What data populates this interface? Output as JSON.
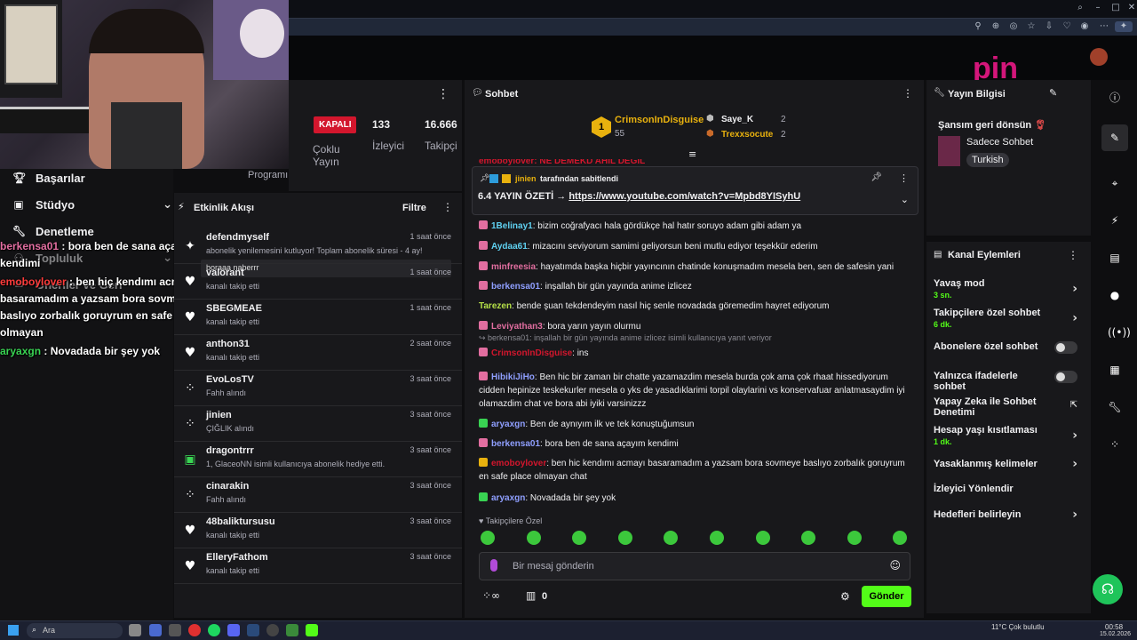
{
  "browser": {
    "icons": [
      "search-icon",
      "minimize-icon",
      "maximize-icon",
      "close-icon"
    ]
  },
  "brand": {
    "logo_text": "pin"
  },
  "left_nav": {
    "items": [
      {
        "label": "Başarılar",
        "icon": "trophy-icon"
      },
      {
        "label": "Stüdyo",
        "icon": "studio-icon"
      },
      {
        "label": "Denetleme",
        "icon": "wrench-icon"
      },
      {
        "label": "Topluluk",
        "icon": "community-icon"
      },
      {
        "label": "Oneriler ve Geri",
        "icon": "feedback-icon"
      }
    ]
  },
  "overlay_chat": [
    {
      "user": "berkensa01",
      "text": " : bora ben de sana açayım kendimi",
      "color": "#e26ea0"
    },
    {
      "user": "emoboylover",
      "text": " : ben hiç kendımı acmayı basaramadım a yazsam bora sovmeye baslıyo zorbalık goruyrum en safe place olmayan",
      "color": "#d3162d"
    },
    {
      "user": "aryaxgn",
      "text": " : Novadada bir şey yok",
      "color": "#39d353"
    }
  ],
  "stream_status": {
    "status": "KAPALI",
    "multi_stream": "Çoklu Yayın",
    "viewers": "133",
    "viewers_label": "İzleyici",
    "followers": "16.666",
    "followers_label": "Takipçi",
    "program_label": "Programı"
  },
  "activity": {
    "title": "Etkinlik Akışı",
    "filter": "Filtre",
    "pinned_input": "boraaa naberrr",
    "rows": [
      {
        "name": "defendmyself",
        "sub": "abonelik yenilemesini kutluyor! Toplam abonelik süresi - 4 ay!",
        "time": "1 saat önce",
        "icon": "star-icon"
      },
      {
        "name": "valorant",
        "sub": "kanalı takip etti",
        "time": "1 saat önce",
        "icon": "heart-icon"
      },
      {
        "name": "SBEGMEAE",
        "sub": "kanalı takip etti",
        "time": "1 saat önce",
        "icon": "heart-icon"
      },
      {
        "name": "anthon31",
        "sub": "kanalı takip etti",
        "time": "2 saat önce",
        "icon": "heart-icon"
      },
      {
        "name": "EvoLosTV",
        "sub": "Fahh alındı",
        "time": "3 saat önce",
        "icon": "reward-icon"
      },
      {
        "name": "jinien",
        "sub": "ÇIĞLIK alındı",
        "time": "3 saat önce",
        "icon": "reward-icon"
      },
      {
        "name": "dragontrrr",
        "sub": "1, GlaceoNN isimli kullanıcıya abonelik hediye etti.",
        "time": "3 saat önce",
        "icon": "gift-icon"
      },
      {
        "name": "cinarakin",
        "sub": "Fahh alındı",
        "time": "3 saat önce",
        "icon": "reward-icon"
      },
      {
        "name": "48baliktursusu",
        "sub": "kanalı takip etti",
        "time": "3 saat önce",
        "icon": "heart-icon"
      },
      {
        "name": "ElleryFathom",
        "sub": "kanalı takip etti",
        "time": "3 saat önce",
        "icon": "heart-icon"
      }
    ]
  },
  "chat": {
    "title": "Sohbet",
    "leaders": {
      "first": {
        "rank": "1",
        "name": "CrimsonInDisguise",
        "count": "55"
      },
      "second": {
        "name": "Saye_K",
        "count": "2"
      },
      "third": {
        "name": "Trexxsocute",
        "count": "2"
      }
    },
    "top_partial": "emoboylover: NE DEMEKD AHIL DEGIL",
    "pinned": {
      "by": "jinien",
      "by_suffix": "tarafından sabitlendi",
      "text": "6.4 YAYIN ÖZETİ → ",
      "link": "https://www.youtube.com/watch?v=Mpbd8YISyhU"
    },
    "messages": [
      {
        "user": "1Belinay1",
        "color": "#5fd0f0",
        "badge": "b-pink",
        "text": ": bizim coğrafyacı hala gördükçe hal hatır soruyo adam gibi adam ya"
      },
      {
        "user": "Aydaa61",
        "color": "#5fd0f0",
        "badge": "b-pink",
        "text": ": mizacını seviyorum samimi geliyorsun beni mutlu ediyor teşekkür ederim"
      },
      {
        "user": "minfreesia",
        "color": "#e26ea0",
        "badge": "b-pink",
        "text": ": hayatımda başka hiçbir yayıncının chatinde konuşmadım mesela ben, sen de safesin yani"
      },
      {
        "user": "berkensa01",
        "color": "#8f9fff",
        "badge": "b-pink",
        "text": ": inşallah bir gün yayında anime izlicez"
      },
      {
        "user": "Tarezen",
        "color": "#b5e048",
        "badge": "",
        "text": ": bende şuan tekdendeyim nasıl hiç senle novadada göremedim hayret ediyorum"
      },
      {
        "user": "Leviyathan3",
        "color": "#e26ea0",
        "badge": "b-pink",
        "text": ": bora yarın yayın olurmu"
      },
      {
        "user": "CrimsonInDisguise",
        "color": "#d3162d",
        "badge": "b-pink",
        "text": ": ins",
        "reply": "berkensa01: inşallah bir gün yayında anime izlicez isimli kullanıcıya yanıt veriyor"
      },
      {
        "user": "HibikiJiHo",
        "color": "#8f9fff",
        "badge": "b-pink",
        "text": ": Ben hic bir zaman bir chatte yazamazdim mesela burda çok ama çok rhaat hissediyorum cidden hepinize teskekurler mesela o yks de yasadıklarimi torpil olaylarini vs konservafuar anlatmasaydim iyi olamazdim chat ve bora abi iyiki varsinizzz"
      },
      {
        "user": "aryaxgn",
        "color": "#8f9fff",
        "badge": "b-green",
        "text": ": Ben de aynıyım ilk ve tek konuştuğumsun"
      },
      {
        "user": "berkensa01",
        "color": "#8f9fff",
        "badge": "b-pink",
        "text": ": bora ben de sana açayım kendimi"
      },
      {
        "user": "emoboylover",
        "color": "#d3162d",
        "badge": "b-gold",
        "text": ": ben hic kendımı acmayı basaramadım a yazsam bora sovmeye baslıyo zorbalık goruyrum en safe place olmayan chat"
      },
      {
        "user": "aryaxgn",
        "color": "#8f9fff",
        "badge": "b-green",
        "text": ": Novadada bir şey yok"
      }
    ],
    "followers_only": "Takipçilere Özel",
    "placeholder": "Bir mesaj gönderin",
    "kick_count": "0",
    "send": "Gönder"
  },
  "stream_info": {
    "title": "Yayın Bilgisi",
    "stream_title": "Şansım geri dönsün",
    "category": "Sadece Sohbet",
    "tag": "Turkish"
  },
  "channel_actions": {
    "title": "Kanal Eylemleri",
    "items": [
      {
        "label": "Yavaş mod",
        "sub": "3 sn.",
        "control": "arrow"
      },
      {
        "label": "Takipçilere özel sohbet",
        "sub": "6 dk.",
        "control": "arrow"
      },
      {
        "label": "Abonelere özel sohbet",
        "sub": "",
        "control": "toggle"
      },
      {
        "label": "Yalnızca ifadelerle sohbet",
        "sub": "",
        "control": "toggle"
      },
      {
        "label": "Yapay Zeka ile Sohbet Denetimi",
        "sub": "",
        "control": "external"
      },
      {
        "label": "Hesap yaşı kısıtlaması",
        "sub": "1 dk.",
        "control": "arrow"
      },
      {
        "label": "Yasaklanmış kelimeler",
        "sub": "",
        "control": "arrow"
      },
      {
        "label": "İzleyici Yönlendir",
        "sub": "",
        "control": "none"
      },
      {
        "label": "Hedefleri belirleyin",
        "sub": "",
        "control": "arrow"
      }
    ]
  },
  "taskbar": {
    "search": "Ara",
    "weather": "11°C Çok bulutlu",
    "time": "00:58",
    "date": "15.02.2026"
  },
  "colors": {
    "accent": "#53fc18",
    "panel": "#18181b",
    "bg": "#0e0e10",
    "live": "#d3162d"
  }
}
